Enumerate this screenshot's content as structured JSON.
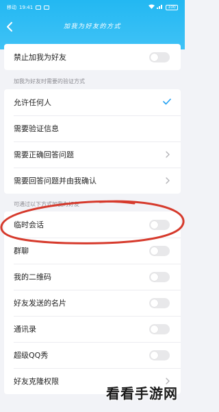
{
  "status_bar": {
    "carrier": "移动",
    "time": "19:41",
    "battery": "100"
  },
  "header": {
    "title": "加我为好友的方式"
  },
  "group1": {
    "ban_add_friend": "禁止加我为好友"
  },
  "section_verify_label": "加我为好友时需要的验证方式",
  "verify_options": [
    "允许任何人",
    "需要验证信息",
    "需要正确回答问题",
    "需要回答问题并由我确认"
  ],
  "section_methods_label": "可通过以下方式加我为好友",
  "methods": [
    "临时会话",
    "群聊",
    "我的二维码",
    "好友发送的名片",
    "通讯录",
    "超级QQ秀",
    "好友克隆权限"
  ],
  "watermark": "看看手游网",
  "colors": {
    "header": "#23b8f2",
    "check": "#1e9ff2",
    "annotation": "#d63a2c"
  }
}
